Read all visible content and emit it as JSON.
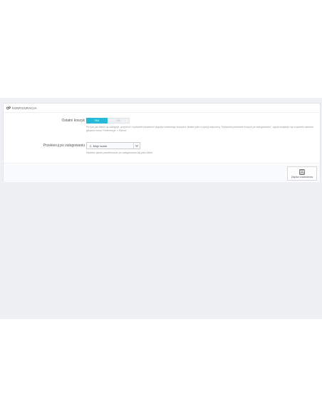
{
  "panel": {
    "title": "KONFIGURACJA",
    "icon": "gears-icon"
  },
  "cart_setting": {
    "label": "Ostatni koszyk",
    "options": {
      "yes": "TAK",
      "no": "NIE"
    },
    "selected": "TAK",
    "help": "Po tym jak klient się zaloguje, przywróć i wyświetl zawartość jego/jej ostatniego koszyka, działa tylko z opcją włączoną \"Wyświetl ponownie koszyk po zalogowaniu\", opcja znajduje się w panelu admina głównie menu Preferencje > Klienci"
  },
  "redirect_setting": {
    "label": "Przekieruj po zalogowaniu",
    "selected_value": "2- Moje konto",
    "help": "Wybierz gdzie przekierować po zalogowaniu się jako klient"
  },
  "footer": {
    "save_label": "Zapisz ustawienia",
    "save_icon": "floppy-disk-icon"
  },
  "colors": {
    "accent": "#25b9d7",
    "background": "#eef0f3"
  }
}
